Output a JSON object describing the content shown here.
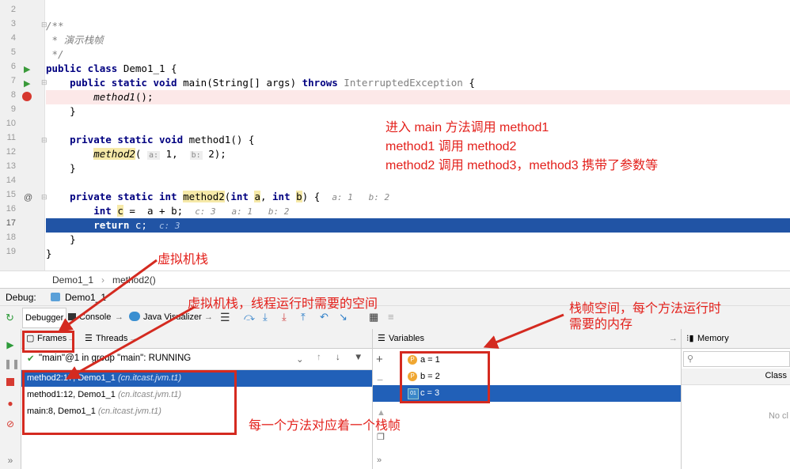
{
  "code": {
    "line_numbers": [
      "2",
      "3",
      "4",
      "5",
      "6",
      "7",
      "8",
      "9",
      "10",
      "11",
      "12",
      "13",
      "14",
      "15",
      "16",
      "17",
      "18",
      "19"
    ],
    "comment_open": "/**",
    "comment_body": " * 演示栈帧",
    "comment_close": " */",
    "class_decl_kw": "public class",
    "class_decl_rest": " Demo1_1 {",
    "main_kw": "public static void",
    "main_sig": " main(String[] args) ",
    "main_throws": "throws",
    "main_exc": " InterruptedException",
    "main_brace": " {",
    "call_method1": "method1",
    "call_method1_rest": "();",
    "close_brace": "}",
    "m1_kw": "private static void",
    "m1_sig": " method1() {",
    "call_method2": "method2",
    "call_method2_open": "( ",
    "hint_a": "a:",
    "arg1": " 1,  ",
    "hint_b": "b:",
    "arg2": " 2);",
    "m2_kw": "private static int",
    "m2_name": "method2",
    "m2_p1kw": "int",
    "m2_p1": "a",
    "m2_p2kw": "int",
    "m2_p2": "b",
    "m2_inline": "a: 1   b: 2",
    "int_kw": "int",
    "c_var": "c",
    "assign": " =  a + b;",
    "assign_inline": "c: 3   a: 1   b: 2",
    "return_kw": "return",
    "return_rest": " c;",
    "return_inline": "c: 3",
    "class_close": "}"
  },
  "breadcrumb": {
    "class": "Demo1_1",
    "sep": "›",
    "method": "method2()"
  },
  "debug": {
    "label": "Debug:",
    "session": "Demo1_1",
    "tab_debugger": "Debugger",
    "tab_console": "Console",
    "tab_visualizer": "Java Visualizer",
    "frames_tab": "Frames",
    "threads_tab": "Threads",
    "thread_select": "\"main\"@1 in group \"main\": RUNNING",
    "frames": [
      {
        "method": "method2:17, Demo1_1",
        "pkg": "(cn.itcast.jvm.t1)"
      },
      {
        "method": "method1:12, Demo1_1",
        "pkg": "(cn.itcast.jvm.t1)"
      },
      {
        "method": "main:8, Demo1_1",
        "pkg": "(cn.itcast.jvm.t1)"
      }
    ],
    "variables_title": "Variables",
    "variables": [
      {
        "badge": "P",
        "text": "a = 1"
      },
      {
        "badge": "P",
        "text": "b = 2"
      },
      {
        "badge": "01",
        "text": "c = 3"
      }
    ],
    "memory_title": "Memory",
    "memory_col": "Class",
    "memory_empty": "No cl"
  },
  "annotations": {
    "note1": "进入 main 方法调用 method1",
    "note2": "method1 调用 method2",
    "note3": "method2 调用 method3，method3 携带了参数等",
    "vm_stack": "虚拟机栈",
    "vm_stack_desc": "虚拟机栈，线程运行时需要的空间",
    "frame_space_1": "栈帧空间，每个方法运行时",
    "frame_space_2": "需要的内存",
    "frame_per_method": "每一个方法对应着一个栈帧"
  },
  "colors": {
    "accent": "#e3201b",
    "selection": "#2160b8"
  }
}
